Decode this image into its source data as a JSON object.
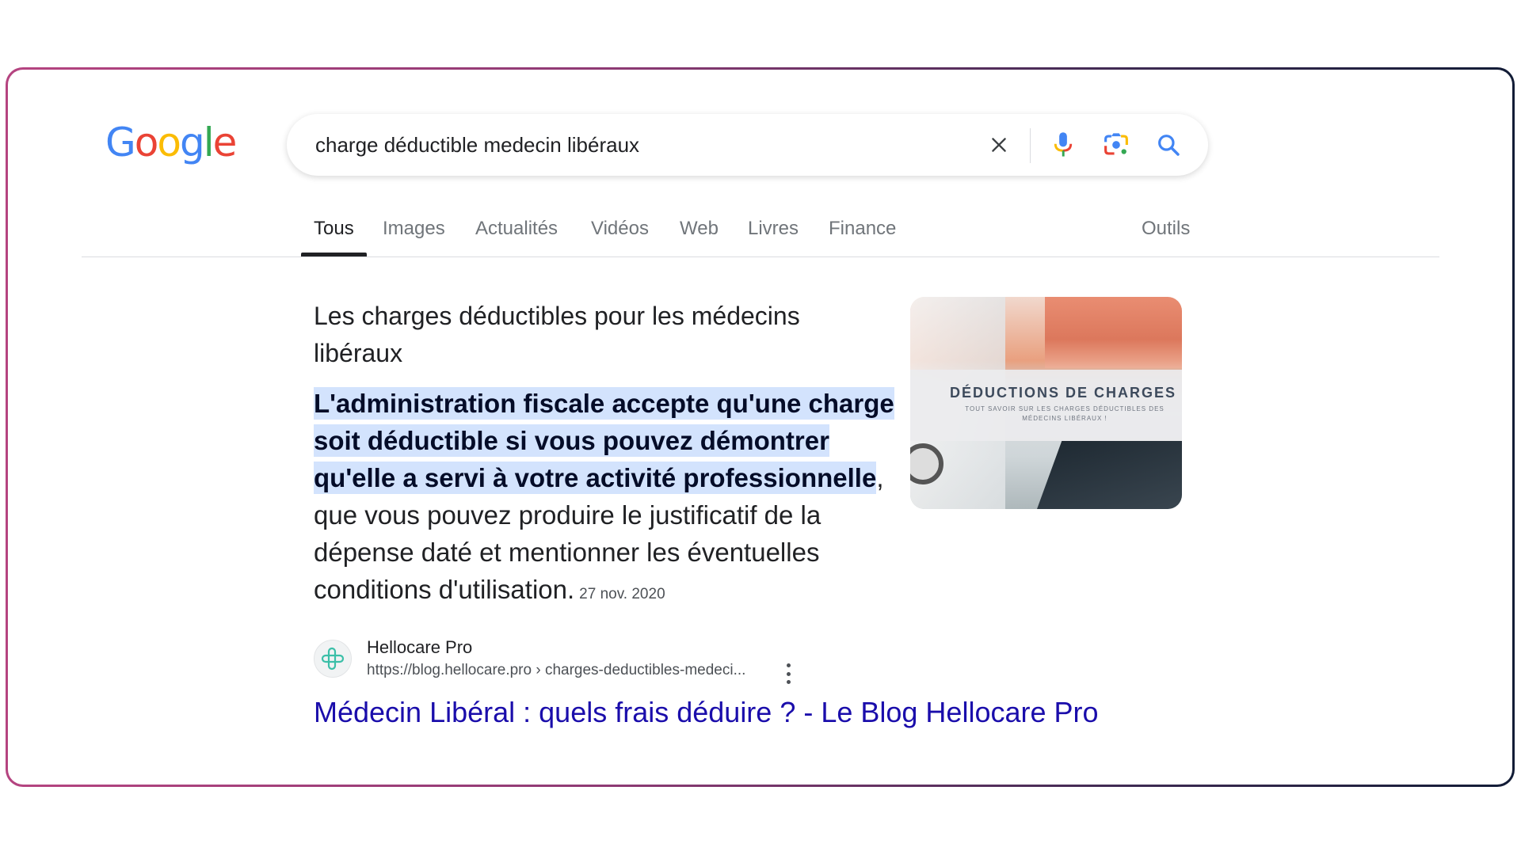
{
  "logo": {
    "text": "Google",
    "letters": [
      {
        "ch": "G",
        "color": "#4285f4"
      },
      {
        "ch": "o",
        "color": "#ea4335"
      },
      {
        "ch": "o",
        "color": "#fbbc05"
      },
      {
        "ch": "g",
        "color": "#4285f4"
      },
      {
        "ch": "l",
        "color": "#34a853"
      },
      {
        "ch": "e",
        "color": "#ea4335"
      }
    ]
  },
  "search": {
    "query": "charge déductible medecin libéraux",
    "icons": [
      "close-icon",
      "microphone-icon",
      "google-lens-icon",
      "search-icon"
    ]
  },
  "tabs": {
    "items": [
      {
        "label": "Tous",
        "active": true
      },
      {
        "label": "Images"
      },
      {
        "label": "Actualités"
      },
      {
        "label": "Vidéos"
      },
      {
        "label": "Web"
      },
      {
        "label": "Livres"
      },
      {
        "label": "Finance"
      }
    ],
    "tools_label": "Outils"
  },
  "featured_snippet": {
    "title": "Les charges déductibles pour les médecins libéraux",
    "highlighted_text": "L'administration fiscale accepte qu'une charge soit déductible si vous pouvez démontrer qu'elle a servi à votre activité professionnelle",
    "rest_text": ", que vous pouvez produire le justificatif de la dépense daté et mentionner les éventuelles conditions d'utilisation.",
    "date": "27 nov. 2020",
    "thumbnail": {
      "heading": "DÉDUCTIONS DE CHARGES",
      "subheading": "TOUT SAVOIR SUR LES CHARGES DÉDUCTIBLES DES MÉDECINS LIBÉRAUX !"
    }
  },
  "source": {
    "site_name": "Hellocare Pro",
    "url": "https://blog.hellocare.pro › charges-deductibles-medeci...",
    "link_title": "Médecin Libéral : quels frais déduire ? - Le Blog Hellocare Pro",
    "link_color": "#1a0dab"
  },
  "colors": {
    "highlight": "#d3e3fd",
    "frame_gradient_start": "#b54480",
    "frame_gradient_end": "#121c36"
  }
}
